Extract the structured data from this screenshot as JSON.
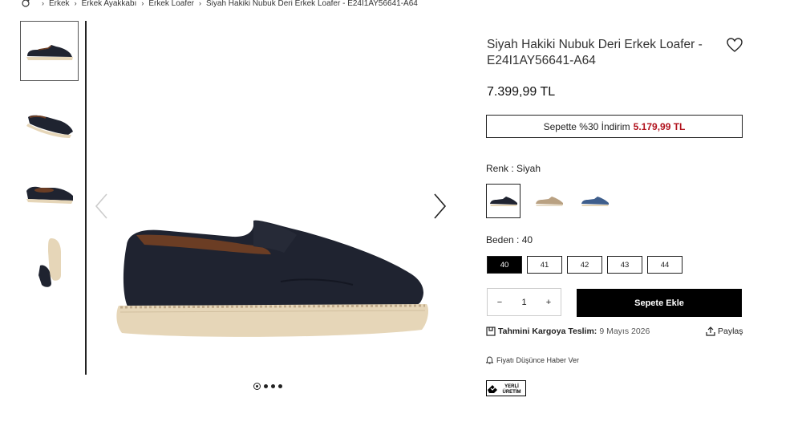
{
  "breadcrumb": {
    "items": [
      "Erkek",
      "Erkek Ayakkabı",
      "Erkek Loafer",
      "Siyah Hakiki Nubuk Deri Erkek Loafer - E24I1AY56641-A64"
    ],
    "separator": "›",
    "home_icon": "home-icon"
  },
  "gallery": {
    "thumbnails": [
      "shoe-side",
      "shoe-angle",
      "shoe-inner",
      "shoe-sole"
    ],
    "active_thumbnail": 0,
    "dots_count": 4,
    "active_dot": 0
  },
  "product": {
    "title": "Siyah Hakiki Nubuk Deri Erkek Loafer - E24I1AY56641-A64",
    "price": "7.399,99 TL",
    "cart_discount_text": "Sepette %30 İndirim",
    "cart_discount_price": "5.179,99 TL"
  },
  "color": {
    "label": "Renk : Siyah",
    "options": [
      "Siyah",
      "Bej",
      "Mavi"
    ],
    "selected": "Siyah"
  },
  "size": {
    "label": "Beden : 40",
    "options": [
      "40",
      "41",
      "42",
      "43",
      "44"
    ],
    "selected": "40"
  },
  "quantity": {
    "minus": "−",
    "value": "1",
    "plus": "+"
  },
  "actions": {
    "add_to_cart": "Sepete Ekle",
    "share": "Paylaş",
    "price_alert": "Fiyatı Düşünce Haber Ver"
  },
  "delivery": {
    "label": "Tahmini Kargoya Teslim:",
    "date": "9 Mayıs 2026"
  },
  "badge": {
    "text_line1": "YERLİ",
    "text_line2": "ÜRETİM"
  },
  "colors": {
    "discount_red": "#b1121d",
    "shoe_navy": "#1f2330",
    "sole_beige": "#e6d6b8"
  }
}
